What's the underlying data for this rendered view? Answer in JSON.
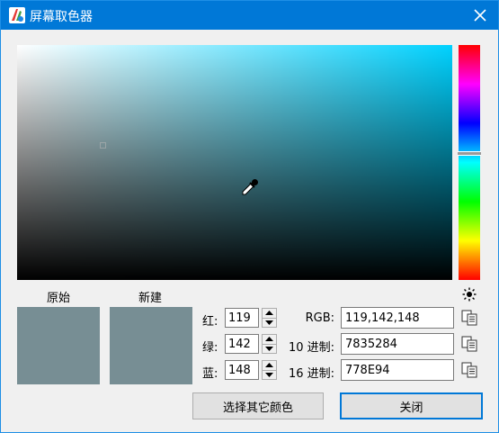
{
  "window": {
    "title": "屏幕取色器"
  },
  "picker": {
    "field_hue_color": "#00d2ff",
    "selected_color": "#778e94"
  },
  "labels": {
    "original": "原始",
    "new": "新建"
  },
  "channels": [
    {
      "label": "红:",
      "value": "119"
    },
    {
      "label": "绿:",
      "value": "142"
    },
    {
      "label": "蓝:",
      "value": "148"
    }
  ],
  "formats": [
    {
      "label": "RGB:",
      "value": "119,142,148"
    },
    {
      "label": "10 进制:",
      "value": "7835284"
    },
    {
      "label": "16 进制:",
      "value": "778E94"
    }
  ],
  "buttons": {
    "pick_other": "选择其它颜色",
    "close": "关闭"
  },
  "icons": {
    "app": "app-logo-icon",
    "close": "close-icon",
    "eyedropper": "eyedropper-icon",
    "brightness": "sun-icon",
    "copy": "copy-icon"
  }
}
